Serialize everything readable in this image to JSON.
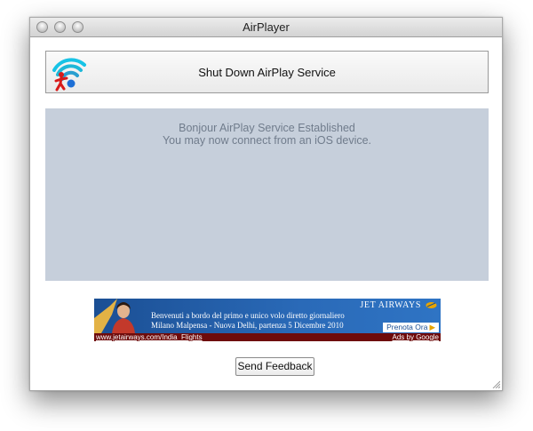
{
  "window": {
    "title": "AirPlayer"
  },
  "toolbar": {
    "shutdown_label": "Shut Down AirPlay Service",
    "icon": "airplay-wifi-icon"
  },
  "status": {
    "line1": "Bonjour AirPlay Service Established",
    "line2": "You may now connect from an iOS device."
  },
  "ad": {
    "brand": "JET AIRWAYS",
    "line1": "Benvenuti a bordo del primo e unico volo diretto giornaliero",
    "line2": "Milano Malpensa - Nuova Delhi, partenza 5 Dicembre 2010",
    "cta": "Prenota Ora",
    "url": "www.jetairways.com/India_Flights",
    "ads_by": "Ads by Google"
  },
  "footer": {
    "feedback_label": "Send Feedback"
  },
  "colors": {
    "panel": "#c6cfdb",
    "status_text": "#707c8c",
    "ad_blue": "#1b4f94",
    "ad_strip": "#6e0b0b"
  }
}
